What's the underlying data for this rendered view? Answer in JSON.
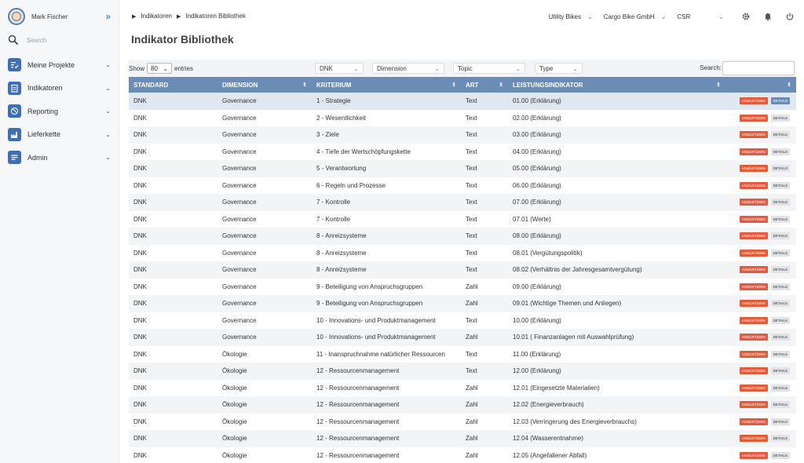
{
  "user": {
    "name": "Mark Fischer"
  },
  "sidebar": {
    "search_placeholder": "Search",
    "items": [
      {
        "label": "Meine Projekte",
        "icon": "checklist-icon"
      },
      {
        "label": "Indikatoren",
        "icon": "clipboard-icon"
      },
      {
        "label": "Reporting",
        "icon": "globe-icon"
      },
      {
        "label": "Lieferkette",
        "icon": "factory-icon"
      },
      {
        "label": "Admin",
        "icon": "list-icon"
      }
    ]
  },
  "breadcrumb": [
    "Indikatoren",
    "Indikatoren Bibliothek"
  ],
  "header": {
    "org": "Utility Bikes",
    "company": "Cargo Bike GmbH",
    "report": "CSR"
  },
  "page": {
    "title": "Indikator Bibliothek"
  },
  "controls": {
    "show_label": "Show",
    "show_value": "80",
    "entries_label": "entries",
    "filters": [
      "DNK",
      "Dimension",
      "Topic",
      "Type"
    ],
    "search_label": "Search:"
  },
  "columns": [
    "STANDARD",
    "DIMENSION",
    "KRITERIUM",
    "ART",
    "LEISTUNGSINDIKATOR",
    ""
  ],
  "actions": {
    "add": "HINZUFÜGEN",
    "details": "DETAILS"
  },
  "colors": {
    "accent": "#6a8cb5",
    "add_button": "#e35b3d",
    "sidebar_icon": "#3f6fb0"
  },
  "rows": [
    [
      "DNK",
      "Governance",
      "1 - Strategie",
      "Text",
      "01.00 (Erklärung)"
    ],
    [
      "DNK",
      "Governance",
      "2 - Wesentlichkeit",
      "Text",
      "02.00 (Erklärung)"
    ],
    [
      "DNK",
      "Governance",
      "3 - Ziele",
      "Text",
      "03.00 (Erklärung)"
    ],
    [
      "DNK",
      "Governance",
      "4 - Tiefe der Wertschöpfungskette",
      "Text",
      "04.00 (Erklärung)"
    ],
    [
      "DNK",
      "Governance",
      "5 - Verantwortung",
      "Text",
      "05.00 (Erklärung)"
    ],
    [
      "DNK",
      "Governance",
      "6 - Regeln und Prozesse",
      "Text",
      "06.00 (Erklärung)"
    ],
    [
      "DNK",
      "Governance",
      "7 - Kontrolle",
      "Text",
      "07.00 (Erklärung)"
    ],
    [
      "DNK",
      "Governance",
      "7 - Kontrolle",
      "Text",
      "07.01 (Werte)"
    ],
    [
      "DNK",
      "Governance",
      "8 - Anreizsysteme",
      "Text",
      "08.00 (Erklärung)"
    ],
    [
      "DNK",
      "Governance",
      "8 - Anreizsysteme",
      "Text",
      "08.01 (Vergütungspolitik)"
    ],
    [
      "DNK",
      "Governance",
      "8 - Anreizsysteme",
      "Text",
      "08.02 (Verhältnis der Jahresgesamtvergütung)"
    ],
    [
      "DNK",
      "Governance",
      "9 - Beteiligung von Anspruchsgruppen",
      "Zahl",
      "09.00 (Erklärung)"
    ],
    [
      "DNK",
      "Governance",
      "9 - Beteiligung von Anspruchsgruppen",
      "Zahl",
      "09.01 (Wichtige Themen und Anliegen)"
    ],
    [
      "DNK",
      "Governance",
      "10 - Innovations- und Produktmanagement",
      "Text",
      "10.00 (Erklärung)"
    ],
    [
      "DNK",
      "Governance",
      "10 - Innovations- und Produktmanagement",
      "Zahl",
      "10.01 ( Finanzanlagen mit Auswahlprüfung)"
    ],
    [
      "DNK",
      "Ökologie",
      "11 - Inanspruchnahme natürlicher Ressourcen",
      "Text",
      "11.00 (Erklärung)"
    ],
    [
      "DNK",
      "Ökologie",
      "12 - Ressourcenmanagement",
      "Text",
      "12.00 (Erklärung)"
    ],
    [
      "DNK",
      "Ökologie",
      "12 - Ressourcenmanagement",
      "Zahl",
      "12.01 (Eingesetzte Materialien)"
    ],
    [
      "DNK",
      "Ökologie",
      "12 - Ressourcenmanagement",
      "Zahl",
      "12.02 (Energieverbrauch)"
    ],
    [
      "DNK",
      "Ökologie",
      "12 - Ressourcenmanagement",
      "Zahl",
      "12.03 (Verringerung des Energieverbrauchs)"
    ],
    [
      "DNK",
      "Ökologie",
      "12 - Ressourcenmanagement",
      "Zahl",
      "12.04 (Wasserentnahme)"
    ],
    [
      "DNK",
      "Ökologie",
      "12 - Ressourcenmanagement",
      "Zahl",
      "12.05 (Angefallener Abfall)"
    ]
  ]
}
